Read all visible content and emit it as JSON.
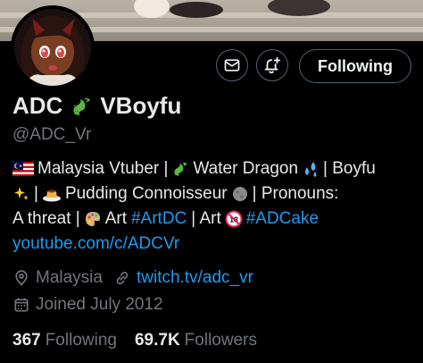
{
  "profile": {
    "display_name_part1": "ADC",
    "display_name_part2": "VBoyfu",
    "handle": "@ADC_Vr",
    "follow_button_label": "Following",
    "bio": {
      "line1_a": "Malaysia Vtuber |",
      "line1_b": "Water Dragon",
      "line1_c": "| Boyfu",
      "line2_a": "|",
      "line2_b": "Pudding Connoisseur",
      "line2_c": "| Pronouns:",
      "line3_a": "A threat |",
      "line3_b": "Art",
      "line3_hashtag1": "#ArtDC",
      "line3_c": "| Art",
      "line3_hashtag2": "#ADCake",
      "link": "youtube.com/c/ADCVr"
    },
    "location": "Malaysia",
    "website": "twitch.tv/adc_vr",
    "joined": "Joined July 2012",
    "following_count": "367",
    "following_label": "Following",
    "followers_count": "69.7K",
    "followers_label": "Followers"
  },
  "icons": {
    "message": "envelope-icon",
    "notify": "bell-plus-icon",
    "location": "location-pin-icon",
    "website": "link-icon",
    "joined": "calendar-icon",
    "dragon": "dragon-emoji",
    "flag": "malaysia-flag-emoji",
    "splash": "water-splash-emoji",
    "sparkles": "sparkles-emoji",
    "pudding": "pudding-emoji",
    "moon": "moon-emoji",
    "palette": "palette-emoji",
    "no18": "no-under-18-emoji"
  },
  "colors": {
    "background": "#000000",
    "text": "#e7e9ea",
    "secondary": "#71767b",
    "link": "#1d9bf0",
    "border": "#536471"
  }
}
